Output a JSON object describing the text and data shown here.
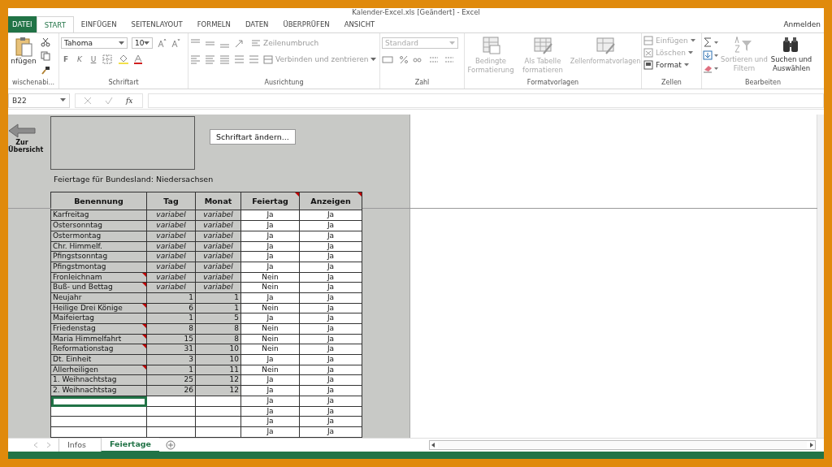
{
  "window": {
    "title": "Kalender-Excel.xls [Geändert] - Excel"
  },
  "menu_tabs": [
    {
      "label": "DATEI",
      "kind": "file",
      "selected": false
    },
    {
      "label": "START",
      "kind": "tab",
      "selected": true
    },
    {
      "label": "EINFÜGEN",
      "kind": "tab",
      "selected": false
    },
    {
      "label": "SEITENLAYOUT",
      "kind": "tab",
      "selected": false
    },
    {
      "label": "FORMELN",
      "kind": "tab",
      "selected": false
    },
    {
      "label": "DATEN",
      "kind": "tab",
      "selected": false
    },
    {
      "label": "ÜBERPRÜFEN",
      "kind": "tab",
      "selected": false
    },
    {
      "label": "ANSICHT",
      "kind": "tab",
      "selected": false
    }
  ],
  "account": {
    "label": "Anmelden"
  },
  "clipboard": {
    "paste": "nfügen",
    "label": "wischenabi..."
  },
  "font": {
    "name": "Tahoma",
    "size": "10",
    "bold": "F",
    "italic": "K",
    "underline": "U",
    "label": "Schriftart"
  },
  "alignment": {
    "wrap": {
      "label": "Zeilenumbruch",
      "disabled": true
    },
    "merge": {
      "label": "Verbinden und zentrieren",
      "disabled": true
    },
    "label": "Ausrichtung"
  },
  "number": {
    "format": {
      "value": "Standard",
      "disabled": true
    },
    "label": "Zahl"
  },
  "styles": {
    "buttons": [
      {
        "label": "Bedingte Formatierung",
        "disabled": true
      },
      {
        "label": "Als Tabelle formatieren",
        "disabled": true
      },
      {
        "label": "Zellenformatvorlagen",
        "disabled": true
      }
    ],
    "label": "Formatvorlagen"
  },
  "cells": {
    "buttons": [
      {
        "label": "Einfügen",
        "disabled": true
      },
      {
        "label": "Löschen",
        "disabled": true
      },
      {
        "label": "Format",
        "disabled": false
      }
    ],
    "label": "Zellen"
  },
  "editing": {
    "buttons": [
      {
        "label": "Sortieren und Filtern",
        "disabled": true
      },
      {
        "label": "Suchen und Auswählen",
        "disabled": false
      }
    ],
    "label": "Bearbeiten"
  },
  "formula_bar": {
    "name_box": "B22",
    "function_label": "fx"
  },
  "sheet": {
    "back_button": "Zur Übersicht",
    "action_button": "Schriftart ändern...",
    "caption": "Feiertage für Bundesland: Niedersachsen",
    "table": {
      "columns": [
        {
          "label": "Benennung",
          "comment": false
        },
        {
          "label": "Tag",
          "comment": false
        },
        {
          "label": "Monat",
          "comment": false
        },
        {
          "label": "Feiertag",
          "comment": true
        },
        {
          "label": "Anzeigen",
          "comment": true
        }
      ],
      "rows": [
        {
          "kind": "variable",
          "name": "Karfreitag",
          "day": "variabel",
          "month": "variabel",
          "holiday": "Ja",
          "show": "Ja",
          "comment": false,
          "selected": false
        },
        {
          "kind": "variable",
          "name": "Ostersonntag",
          "day": "variabel",
          "month": "variabel",
          "holiday": "Ja",
          "show": "Ja",
          "comment": false,
          "selected": false
        },
        {
          "kind": "variable",
          "name": "Ostermontag",
          "day": "variabel",
          "month": "variabel",
          "holiday": "Ja",
          "show": "Ja",
          "comment": false,
          "selected": false
        },
        {
          "kind": "variable",
          "name": "Chr. Himmelf.",
          "day": "variabel",
          "month": "variabel",
          "holiday": "Ja",
          "show": "Ja",
          "comment": false,
          "selected": false
        },
        {
          "kind": "variable",
          "name": "Pfingstsonntag",
          "day": "variabel",
          "month": "variabel",
          "holiday": "Ja",
          "show": "Ja",
          "comment": false,
          "selected": false
        },
        {
          "kind": "variable",
          "name": "Pfingstmontag",
          "day": "variabel",
          "month": "variabel",
          "holiday": "Ja",
          "show": "Ja",
          "comment": false,
          "selected": false
        },
        {
          "kind": "variable",
          "name": "Fronleichnam",
          "day": "variabel",
          "month": "variabel",
          "holiday": "Nein",
          "show": "Ja",
          "comment": true,
          "selected": false
        },
        {
          "kind": "variable",
          "name": "Buß- und Bettag",
          "day": "variabel",
          "month": "variabel",
          "holiday": "Nein",
          "show": "Ja",
          "comment": true,
          "selected": false
        },
        {
          "kind": "fixed",
          "name": "Neujahr",
          "day": "1",
          "month": "1",
          "holiday": "Ja",
          "show": "Ja",
          "comment": false,
          "selected": false
        },
        {
          "kind": "fixed",
          "name": "Heilige Drei Könige",
          "day": "6",
          "month": "1",
          "holiday": "Nein",
          "show": "Ja",
          "comment": true,
          "selected": false
        },
        {
          "kind": "fixed",
          "name": "Maifeiertag",
          "day": "1",
          "month": "5",
          "holiday": "Ja",
          "show": "Ja",
          "comment": false,
          "selected": false
        },
        {
          "kind": "fixed",
          "name": "Friedenstag",
          "day": "8",
          "month": "8",
          "holiday": "Nein",
          "show": "Ja",
          "comment": true,
          "selected": false
        },
        {
          "kind": "fixed",
          "name": "Maria Himmelfahrt",
          "day": "15",
          "month": "8",
          "holiday": "Nein",
          "show": "Ja",
          "comment": true,
          "selected": false
        },
        {
          "kind": "fixed",
          "name": "Reformationstag",
          "day": "31",
          "month": "10",
          "holiday": "Nein",
          "show": "Ja",
          "comment": true,
          "selected": false
        },
        {
          "kind": "fixed",
          "name": "Dt. Einheit",
          "day": "3",
          "month": "10",
          "holiday": "Ja",
          "show": "Ja",
          "comment": false,
          "selected": false
        },
        {
          "kind": "fixed",
          "name": "Allerheiligen",
          "day": "1",
          "month": "11",
          "holiday": "Nein",
          "show": "Ja",
          "comment": true,
          "selected": false
        },
        {
          "kind": "fixed",
          "name": "1. Weihnachtstag",
          "day": "25",
          "month": "12",
          "holiday": "Ja",
          "show": "Ja",
          "comment": false,
          "selected": false
        },
        {
          "kind": "fixed",
          "name": "2. Weihnachtstag",
          "day": "26",
          "month": "12",
          "holiday": "Ja",
          "show": "Ja",
          "comment": false,
          "selected": false
        },
        {
          "kind": "blank",
          "holiday": "Ja",
          "show": "Ja",
          "comment": false,
          "selected": true
        },
        {
          "kind": "blank",
          "holiday": "Ja",
          "show": "Ja",
          "comment": false,
          "selected": false
        },
        {
          "kind": "blank",
          "holiday": "Ja",
          "show": "Ja",
          "comment": false,
          "selected": false
        },
        {
          "kind": "blank",
          "holiday": "Ja",
          "show": "Ja",
          "comment": false,
          "selected": false
        }
      ]
    }
  },
  "sheet_tabs": [
    {
      "label": "Infos",
      "selected": false
    },
    {
      "label": "Feiertage",
      "selected": true
    }
  ]
}
